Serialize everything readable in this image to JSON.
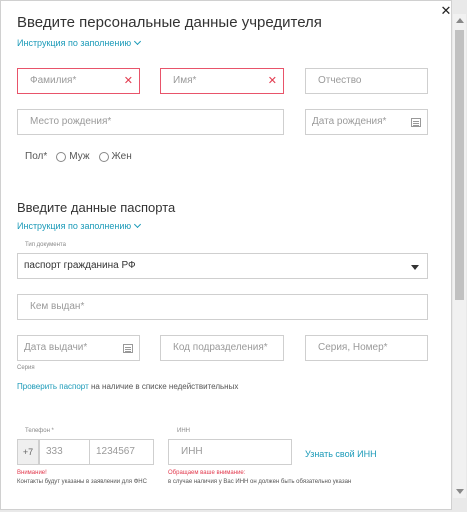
{
  "founder": {
    "title": "Введите персональные данные учредителя",
    "instruction_link": "Инструкция по заполнению",
    "surname_placeholder": "Фамилия*",
    "name_placeholder": "Имя*",
    "patronymic_placeholder": "Отчество",
    "birthplace_placeholder": "Место рождения*",
    "birthdate_placeholder": "Дата рождения*",
    "gender_label": "Пол*",
    "gender_male": "Муж",
    "gender_female": "Жен"
  },
  "passport": {
    "title": "Введите данные паспорта",
    "instruction_link": "Инструкция по заполнению",
    "doc_type_label": "Тип документа",
    "doc_type_value": "паспорт гражданина РФ",
    "issued_by_placeholder": "Кем выдан*",
    "issue_date_placeholder": "Дата выдачи*",
    "division_code_placeholder": "Код подразделения*",
    "series_number_placeholder": "Серия, Номер*",
    "series_label": "Серия",
    "check_link": "Проверить паспорт",
    "check_text": " на наличие в списке недействительных"
  },
  "contacts": {
    "phone_label": "Телефон *",
    "phone_prefix": "+7",
    "phone_code_placeholder": "333",
    "phone_number_placeholder": "1234567",
    "phone_warning": "Внимание!",
    "phone_note": "Контакты будут указаны в заявлении для ФНС",
    "inn_label": "ИНН",
    "inn_placeholder": "ИНН",
    "inn_warning": "Обращаем ваше внимание:",
    "inn_note": "в случае наличия у Вас ИНН он должен быть обязательно указан",
    "inn_link": "Узнать свой ИНН"
  },
  "icons": {
    "close": "close-icon",
    "chevron": "chevron-down-icon",
    "calendar": "calendar-icon",
    "error": "error-x-icon"
  },
  "colors": {
    "accent": "#1a9ab8",
    "error": "#e23a4e"
  }
}
